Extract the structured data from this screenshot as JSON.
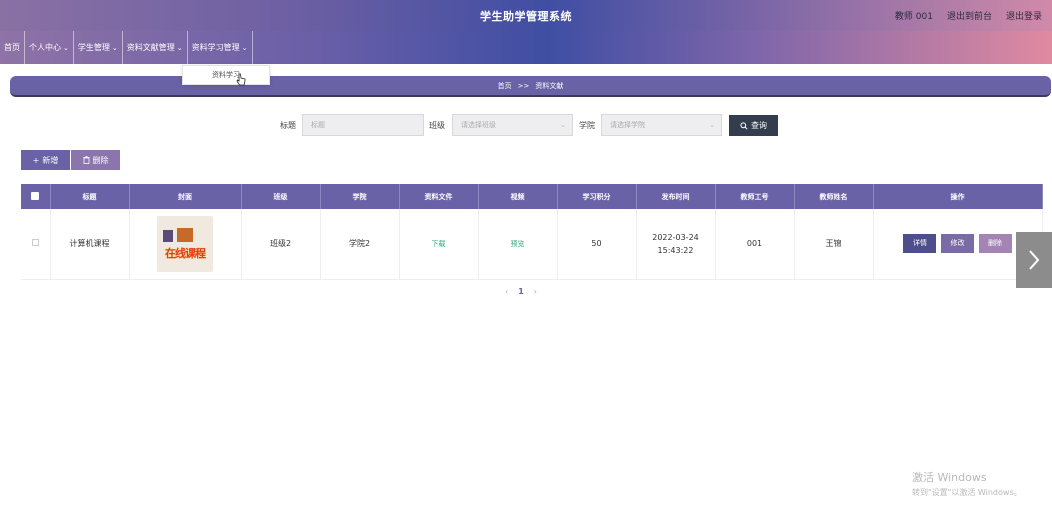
{
  "header": {
    "title": "学生助学管理系统",
    "user": "教师 001",
    "back_to_front": "退出到前台",
    "logout": "退出登录"
  },
  "nav": {
    "items": [
      {
        "label": "首页",
        "has_caret": false
      },
      {
        "label": "个人中心",
        "has_caret": true
      },
      {
        "label": "学生管理",
        "has_caret": true
      },
      {
        "label": "资料文献管理",
        "has_caret": true
      },
      {
        "label": "资料学习管理",
        "has_caret": true
      }
    ],
    "dropdown_item": "资料学习"
  },
  "breadcrumb": {
    "home": "首页",
    "separator": ">>",
    "current": "资料文献"
  },
  "search": {
    "title_label": "标题",
    "title_placeholder": "标题",
    "class_label": "班级",
    "class_placeholder": "请选择班级",
    "college_label": "学院",
    "college_placeholder": "请选择学院",
    "search_button": "查询"
  },
  "actions": {
    "add_label": "新增",
    "delete_label": "删除"
  },
  "table": {
    "columns": [
      "标题",
      "封面",
      "班级",
      "学院",
      "资料文件",
      "视频",
      "学习积分",
      "发布时间",
      "教师工号",
      "教师姓名",
      "操作"
    ],
    "rows": [
      {
        "title": "计算机课程",
        "cover_text": "在线课程",
        "class": "班级2",
        "college": "学院2",
        "file": "下载",
        "video": "预览",
        "points": "50",
        "publish_time": "2022-03-24 15:43:22",
        "teacher_id": "001",
        "teacher_name": "王锦",
        "detail": "详情",
        "edit": "修改",
        "delete": "删除"
      }
    ]
  },
  "pagination": {
    "prev": "‹",
    "current": "1",
    "next": "›"
  },
  "watermark": {
    "line1": "激活 Windows",
    "line2": "转到\"设置\"以激活 Windows。"
  },
  "colors": {
    "primary": "#6a62a6",
    "search_button": "#333d4d",
    "link": "#2aa87a"
  }
}
